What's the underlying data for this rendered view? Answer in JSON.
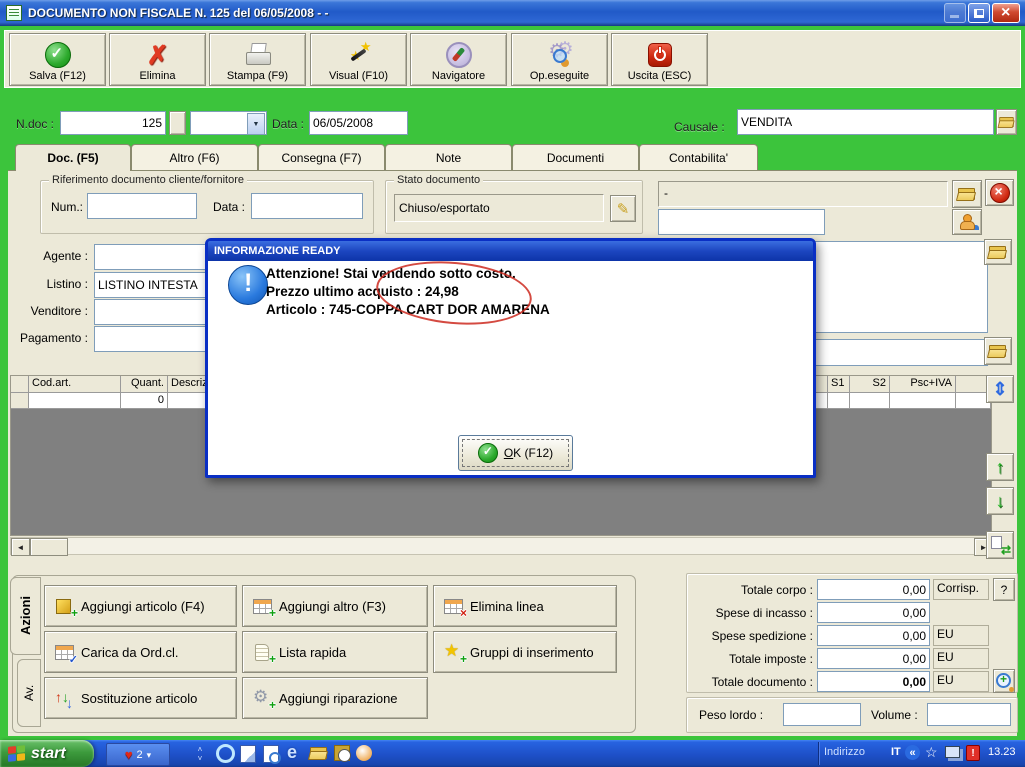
{
  "window": {
    "title": "DOCUMENTO NON FISCALE N. 125  del 06/05/2008 - -"
  },
  "toolbar": {
    "buttons": [
      {
        "label": "Salva (F12)",
        "icon": "save-check-icon"
      },
      {
        "label": "Elimina",
        "icon": "delete-x-icon"
      },
      {
        "label": "Stampa (F9)",
        "icon": "printer-icon"
      },
      {
        "label": "Visual (F10)",
        "icon": "magic-wand-icon"
      },
      {
        "label": "Navigatore",
        "icon": "compass-icon"
      },
      {
        "label": "Op.eseguite",
        "icon": "gears-magnifier-icon"
      },
      {
        "label": "Uscita (ESC)",
        "icon": "power-icon"
      }
    ]
  },
  "doc_header": {
    "ndoc_label": "N.doc :",
    "ndoc_value": "125",
    "data_label": "Data :",
    "data_value": "06/05/2008",
    "causale_label": "Causale :",
    "causale_value": "VENDITA"
  },
  "tabs": [
    {
      "label": "Doc. (F5)"
    },
    {
      "label": "Altro (F6)"
    },
    {
      "label": "Consegna (F7)"
    },
    {
      "label": "Note"
    },
    {
      "label": "Documenti"
    },
    {
      "label": "Contabilita'"
    }
  ],
  "panel": {
    "rif_title": "Riferimento documento cliente/fornitore",
    "num_label": "Num.:",
    "rif_data_label": "Data :",
    "stato_title": "Stato documento",
    "stato_value": "Chiuso/esportato",
    "dash_value": "-",
    "agente_label": "Agente :",
    "listino_label": "Listino :",
    "listino_value": "LISTINO INTESTA",
    "venditore_label": "Venditore :",
    "pagamento_label": "Pagamento :"
  },
  "table": {
    "headers": {
      "codart": "Cod.art.",
      "quant": "Quant.",
      "descr": "Descrizi",
      "s1": "S1",
      "s2": "S2",
      "psc": "Psc+IVA"
    },
    "row": {
      "quant": "0"
    }
  },
  "dialog": {
    "title": "INFORMAZIONE READY",
    "line1": "Attenzione! Stai vendendo sotto costo.",
    "line2": "Prezzo ultimo acquisto : 24,98",
    "line3": "Articolo : 745-COPPA CART DOR AMARENA",
    "ok_prefix": "O",
    "ok_suffix": "K (F12)"
  },
  "actions": {
    "tab1": "Azioni",
    "tab2": "Av.",
    "buttons": [
      {
        "label": "Aggiungi articolo (F4)"
      },
      {
        "label": "Aggiungi altro (F3)"
      },
      {
        "label": "Elimina linea"
      },
      {
        "label": "Carica da Ord.cl."
      },
      {
        "label": "Lista rapida"
      },
      {
        "label": "Gruppi di inserimento"
      },
      {
        "label": "Sostituzione articolo"
      },
      {
        "label": "Aggiungi riparazione"
      }
    ]
  },
  "totals": {
    "rows": [
      {
        "label": "Totale corpo :",
        "value": "0,00",
        "suffix": "Corrisp."
      },
      {
        "label": "Spese di incasso :",
        "value": "0,00",
        "suffix": ""
      },
      {
        "label": "Spese spedizione :",
        "value": "0,00",
        "suffix": "EU"
      },
      {
        "label": "Totale imposte :",
        "value": "0,00",
        "suffix": "EU"
      },
      {
        "label": "Totale documento :",
        "value": "0,00",
        "suffix": "EU"
      }
    ],
    "help": "?",
    "peso_label": "Peso lordo :",
    "volume_label": "Volume :"
  },
  "taskbar": {
    "start": "start",
    "badge": "2",
    "indirizzo": "Indirizzo",
    "lang": "IT",
    "clock": "13.23"
  }
}
